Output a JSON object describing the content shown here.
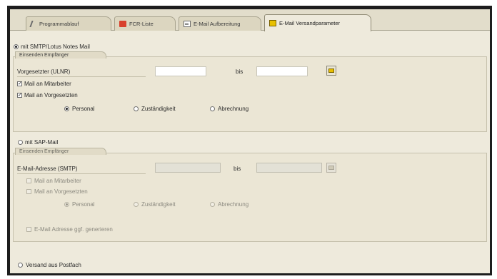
{
  "tabs": [
    {
      "label": "Programmablauf",
      "icon": "pen-icon"
    },
    {
      "label": "FCR-Liste",
      "icon": "red-list-icon"
    },
    {
      "label": "E-Mail Aufbereitung",
      "icon": "document-icon"
    },
    {
      "label": "E-Mail Versandparameter",
      "icon": "mail-icon"
    }
  ],
  "section1": {
    "radio_label": "mit SMTP/Lotus Notes Mail",
    "group_title": "Einsenden Empfänger",
    "range_label": "Vorgesetzter (ULNR)",
    "range_from": "",
    "range_to_label": "bis",
    "range_to": "",
    "chk_mitarbeiter": "Mail an Mitarbeiter",
    "chk_vorgesetzter": "Mail an Vorgesetzten",
    "options": [
      "Personal",
      "Zuständigkeit",
      "Abrechnung"
    ]
  },
  "section2": {
    "radio_label": "mit SAP-Mail",
    "group_title": "Einsenden Empfänger",
    "range_label": "E-Mail-Adresse (SMTP)",
    "range_from": "",
    "range_to_label": "bis",
    "range_to": "",
    "chk_mitarbeiter": "Mail an Mitarbeiter",
    "chk_vorgesetzter": "Mail an Vorgesetzten",
    "options": [
      "Personal",
      "Zuständigkeit",
      "Abrechnung"
    ],
    "chk_email_generate": "E-Mail Adresse ggf. generieren"
  },
  "section3": {
    "radio_label": "Versand aus Postfach"
  },
  "colors": {
    "background": "#eeeadc",
    "frame": "#1d1d1d",
    "accent": "#e8be00"
  }
}
